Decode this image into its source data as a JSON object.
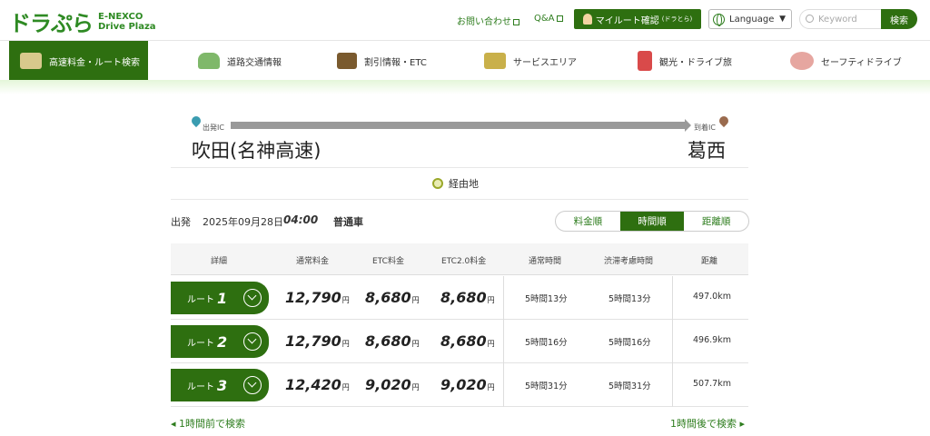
{
  "header": {
    "logo_main": "ドラぷら",
    "logo_sub1": "E-NEXCO",
    "logo_sub2": "Drive Plaza",
    "contact": "お問い合わせ",
    "qa": "Q&A",
    "myroute": "マイルート確認",
    "myroute_small": "(ドラとら)",
    "language": "Language",
    "search_placeholder": "Keyword",
    "search_button": "検索"
  },
  "nav": {
    "items": [
      {
        "label": "高速料金・ルート検索"
      },
      {
        "label": "道路交通情報"
      },
      {
        "label": "割引情報・ETC"
      },
      {
        "label": "サービスエリア"
      },
      {
        "label": "観光・ドライブ旅"
      },
      {
        "label": "セーフティドライブ"
      }
    ]
  },
  "route": {
    "start_label": "出発IC",
    "end_label": "到着IC",
    "start_name": "吹田(名神高速)",
    "end_name": "葛西",
    "via": "経由地"
  },
  "conditions": {
    "depart_label": "出発",
    "date": "2025年09月28日",
    "time": "04:00",
    "vehicle": "普通車"
  },
  "sort": {
    "options": [
      "料金順",
      "時間順",
      "距離順"
    ],
    "active": "時間順"
  },
  "table": {
    "headers": [
      "詳細",
      "通常料金",
      "ETC料金",
      "ETC2.0料金",
      "通常時間",
      "渋滞考慮時間",
      "距離"
    ],
    "yen": "円",
    "route_label": "ルート",
    "rows": [
      {
        "num": "1",
        "normal": "12,790",
        "etc": "8,680",
        "etc2": "8,680",
        "time": "5時間13分",
        "jam_time": "5時間13分",
        "distance": "497.0km"
      },
      {
        "num": "2",
        "normal": "12,790",
        "etc": "8,680",
        "etc2": "8,680",
        "time": "5時間16分",
        "jam_time": "5時間16分",
        "distance": "496.9km"
      },
      {
        "num": "3",
        "normal": "12,420",
        "etc": "9,020",
        "etc2": "9,020",
        "time": "5時間31分",
        "jam_time": "5時間31分",
        "distance": "507.7km"
      }
    ]
  },
  "pager": {
    "prev": "◂ 1時間前で検索",
    "next": "1時間後で検索 ▸"
  },
  "colors": {
    "brand_green": "#2e6f10",
    "link_green": "#2e7d1e"
  }
}
